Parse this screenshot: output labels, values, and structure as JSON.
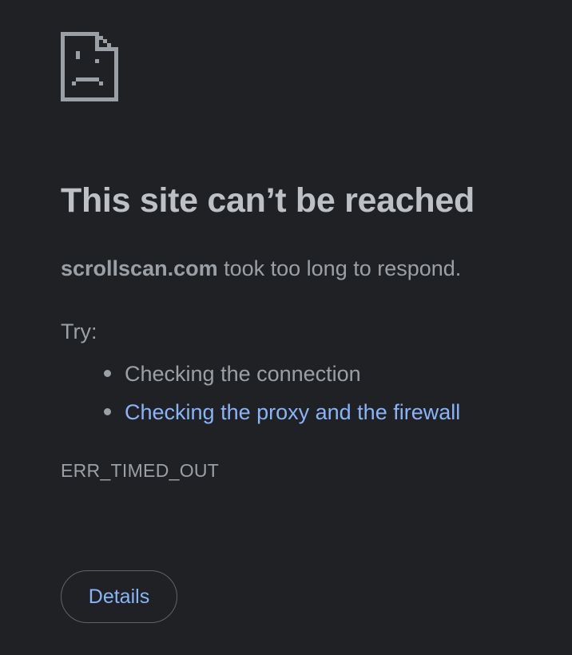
{
  "icon": "sad-page-icon",
  "headline": "This site can’t be reached",
  "summary": {
    "host": "scrollscan.com",
    "message": " took too long to respond."
  },
  "try_label": "Try:",
  "suggestions": [
    {
      "text": "Checking the connection",
      "is_link": false
    },
    {
      "text": "Checking the proxy and the firewall",
      "is_link": true
    }
  ],
  "error_code": "ERR_TIMED_OUT",
  "details_button": "Details",
  "colors": {
    "background": "#202124",
    "text": "#9aa0a6",
    "headline": "#bdc1c6",
    "link": "#8ab4f8",
    "button_border": "#5f6368"
  }
}
